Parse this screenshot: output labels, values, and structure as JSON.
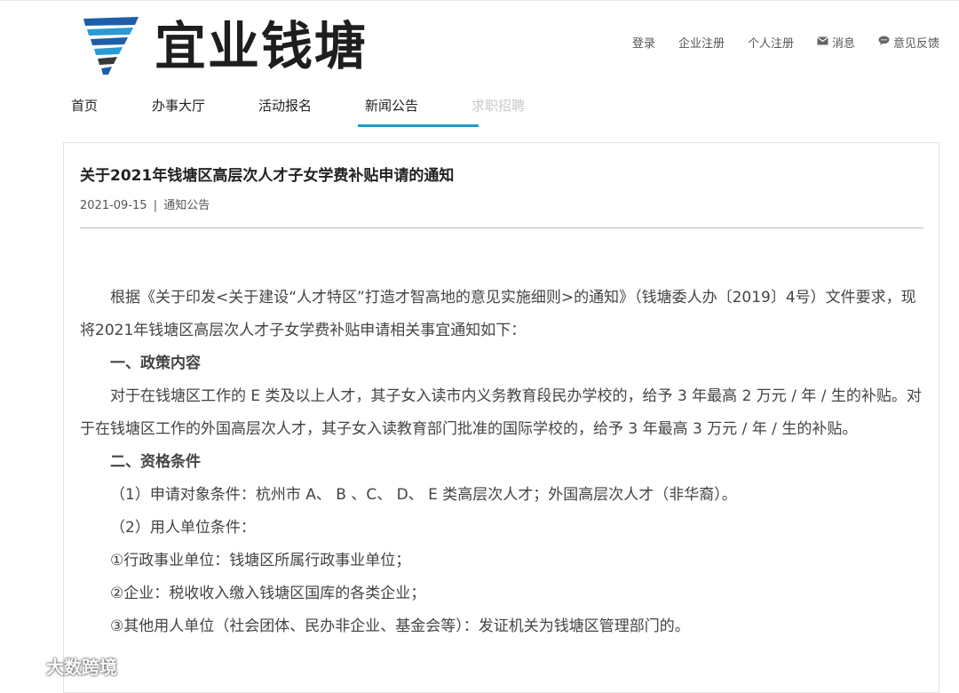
{
  "brand": {
    "name": "宜业钱塘",
    "accent": "#1a9fc7",
    "logo_colors": [
      "#1d5ea8",
      "#2a9ad4",
      "#3a3a3a"
    ]
  },
  "top_links": [
    {
      "label": "登录",
      "icon": null
    },
    {
      "label": "企业注册",
      "icon": null
    },
    {
      "label": "个人注册",
      "icon": null
    },
    {
      "label": "消息",
      "icon": "envelope-icon"
    },
    {
      "label": "意见反馈",
      "icon": "chat-bubble-icon"
    }
  ],
  "nav": [
    {
      "label": "首页",
      "active": false
    },
    {
      "label": "办事大厅",
      "active": false
    },
    {
      "label": "活动报名",
      "active": false
    },
    {
      "label": "新闻公告",
      "active": true
    },
    {
      "label": "求职招聘",
      "active": false,
      "muted": true
    }
  ],
  "article": {
    "title": "关于2021年钱塘区高层次人才子女学费补贴申请的通知",
    "date": "2021-09-15",
    "separator": "|",
    "category": "通知公告",
    "paragraphs": [
      {
        "text": "根据《关于印发<关于建设“人才特区”打造才智高地的意见实施细则>的通知》（钱塘委人办〔2019〕4号）文件要求，现将2021年钱塘区高层次人才子女学费补贴申请相关事宜通知如下：",
        "style": "ind"
      },
      {
        "text": "一、政策内容",
        "style": "ind strong"
      },
      {
        "text": "对于在钱塘区工作的 E 类及以上人才，其子女入读市内义务教育段民办学校的，给予 3 年最高 2 万元 / 年 / 生的补贴。对于在钱塘区工作的外国高层次人才，其子女入读教育部门批准的国际学校的，给予 3 年最高 3 万元 / 年 / 生的补贴。",
        "style": "ind"
      },
      {
        "text": "二、资格条件",
        "style": "ind strong"
      },
      {
        "text": "（1）申请对象条件：杭州市 A、 B 、C、 D、 E 类高层次人才；外国高层次人才（非华裔）。",
        "style": "ind-s"
      },
      {
        "text": "（2）用人单位条件：",
        "style": "ind-s"
      },
      {
        "text": "①行政事业单位：钱塘区所属行政事业单位；",
        "style": "ind-s"
      },
      {
        "text": "②企业：税收收入缴入钱塘区国库的各类企业；",
        "style": "ind-s"
      },
      {
        "text": "③其他用人单位（社会团体、民办非企业、基金会等）：发证机关为钱塘区管理部门的。",
        "style": "ind-s"
      }
    ]
  },
  "watermark": {
    "text": "大数跨境",
    "icon": "weibo-icon"
  }
}
